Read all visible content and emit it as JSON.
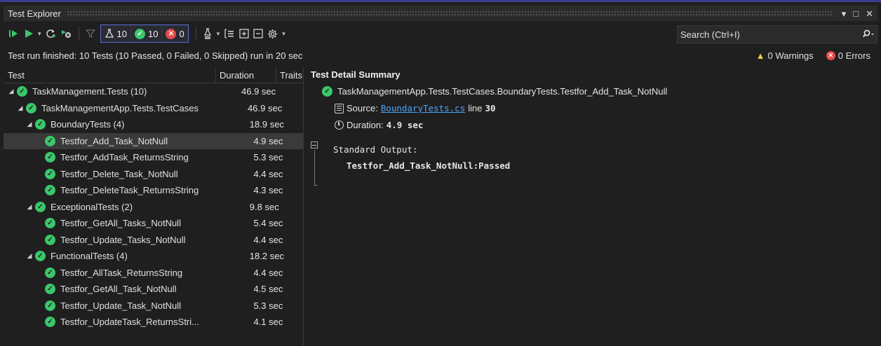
{
  "window": {
    "title": "Test Explorer",
    "buttons": [
      "▾",
      "□",
      "✕"
    ]
  },
  "toolbar": {
    "counters": {
      "total": "10",
      "passed": "10",
      "failed": "0"
    },
    "search_placeholder": "Search (Ctrl+I)"
  },
  "status": {
    "text": "Test run finished: 10 Tests (10 Passed, 0 Failed, 0 Skipped) run in 20 sec",
    "warnings": "0 Warnings",
    "errors": "0 Errors"
  },
  "columns": {
    "test": "Test",
    "duration": "Duration",
    "traits": "Traits"
  },
  "tree": [
    {
      "name": "TaskManagement.Tests (10)",
      "duration": "46.9 sec",
      "level": 0,
      "expander": true
    },
    {
      "name": "TaskManagementApp.Tests.TestCases",
      "duration": "46.9 sec",
      "level": 1,
      "expander": true
    },
    {
      "name": "BoundaryTests (4)",
      "duration": "18.9 sec",
      "level": 2,
      "expander": true
    },
    {
      "name": "Testfor_Add_Task_NotNull",
      "duration": "4.9 sec",
      "level": 3,
      "expander": false,
      "selected": true
    },
    {
      "name": "Testfor_AddTask_ReturnsString",
      "duration": "5.3 sec",
      "level": 3,
      "expander": false
    },
    {
      "name": "Testfor_Delete_Task_NotNull",
      "duration": "4.4 sec",
      "level": 3,
      "expander": false
    },
    {
      "name": "Testfor_DeleteTask_ReturnsString",
      "duration": "4.3 sec",
      "level": 3,
      "expander": false
    },
    {
      "name": "ExceptionalTests (2)",
      "duration": "9.8 sec",
      "level": 2,
      "expander": true
    },
    {
      "name": "Testfor_GetAll_Tasks_NotNull",
      "duration": "5.4 sec",
      "level": 3,
      "expander": false
    },
    {
      "name": "Testfor_Update_Tasks_NotNull",
      "duration": "4.4 sec",
      "level": 3,
      "expander": false
    },
    {
      "name": "FunctionalTests (4)",
      "duration": "18.2 sec",
      "level": 2,
      "expander": true
    },
    {
      "name": "Testfor_AllTask_ReturnsString",
      "duration": "4.4 sec",
      "level": 3,
      "expander": false
    },
    {
      "name": "Testfor_GetAll_Task_NotNull",
      "duration": "4.5 sec",
      "level": 3,
      "expander": false
    },
    {
      "name": "Testfor_Update_Task_NotNull",
      "duration": "5.3 sec",
      "level": 3,
      "expander": false
    },
    {
      "name": "Testfor_UpdateTask_ReturnsStri...",
      "duration": "4.1 sec",
      "level": 3,
      "expander": false
    }
  ],
  "detail": {
    "title": "Test Detail Summary",
    "test_full_name": "TaskManagementApp.Tests.TestCases.BoundaryTests.Testfor_Add_Task_NotNull",
    "source_label": "Source:",
    "source_file": "BoundaryTests.cs",
    "source_line_label": "line",
    "source_line": "30",
    "duration_label": "Duration:",
    "duration_value": "4.9 sec",
    "std_output_label": "Standard Output:",
    "std_output_text": "Testfor_Add_Task_NotNull:Passed"
  },
  "colors": {
    "pass": "#3ac76b",
    "fail": "#e84a4a",
    "warning": "#f2c744",
    "link": "#4aa3ff",
    "background": "#1f1f1f"
  },
  "icons": [
    "run-all-icon",
    "run-icon",
    "repeat-last-run-icon",
    "cancel-icon",
    "filter-icon",
    "flask-icon",
    "check-icon",
    "error-icon",
    "playlist-icon",
    "group-by-icon",
    "expand-all-icon",
    "collapse-all-icon",
    "settings-icon",
    "search-icon",
    "warning-icon",
    "document-icon",
    "clock-icon"
  ]
}
